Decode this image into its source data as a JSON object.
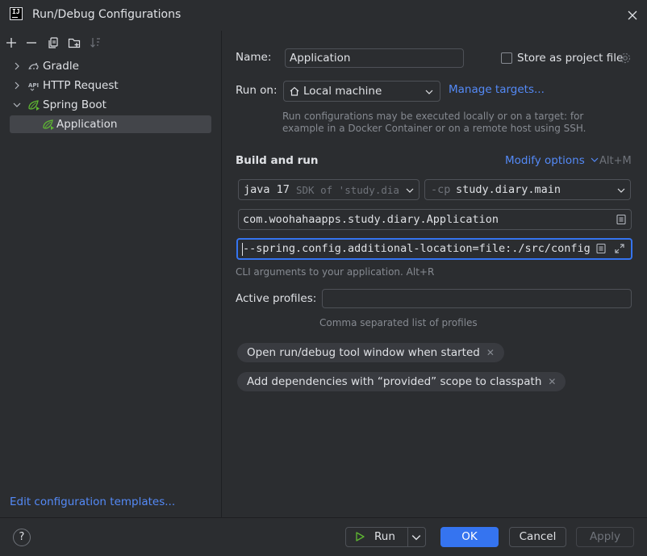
{
  "window": {
    "title": "Run/Debug Configurations",
    "app_icon_text": "IJ"
  },
  "left": {
    "tree": [
      {
        "label": "Gradle",
        "icon": "gradle-icon"
      },
      {
        "label": "HTTP Request",
        "icon": "http-request-icon"
      },
      {
        "label": "Spring Boot",
        "icon": "spring-boot-icon"
      },
      {
        "label": "Application",
        "icon": "spring-boot-icon"
      }
    ],
    "edit_templates": "Edit configuration templates..."
  },
  "form": {
    "name_label": "Name:",
    "name_value": "Application",
    "store_project_file": "Store as project file",
    "run_on_label": "Run on:",
    "run_on_value": "Local machine",
    "manage_targets": "Manage targets...",
    "run_on_hint_1": "Run configurations may be executed locally or on a target: for",
    "run_on_hint_2": "example in a Docker Container or on a remote host using SSH.",
    "build_run_heading": "Build and run",
    "modify_options": "Modify options",
    "modify_shortcut": "Alt+M",
    "jdk_main": "java 17",
    "jdk_detail": "SDK of 'study.dia",
    "cp_prefix": "-cp",
    "cp_value": "study.diary.main",
    "main_class": "com.woohahaapps.study.diary.Application",
    "program_args": "--spring.config.additional-location=file:./src/config/",
    "args_hint": "CLI arguments to your application. Alt+R",
    "active_profiles_label": "Active profiles:",
    "active_profiles_value": "",
    "profiles_hint": "Comma separated list of profiles",
    "chip_1": "Open run/debug tool window when started",
    "chip_2": "Add dependencies with “provided” scope to classpath"
  },
  "footer": {
    "help": "?",
    "run": "Run",
    "ok": "OK",
    "cancel": "Cancel",
    "apply": "Apply"
  },
  "colors": {
    "accent": "#3574f0",
    "link": "#548af7",
    "spring": "#5fb832"
  }
}
